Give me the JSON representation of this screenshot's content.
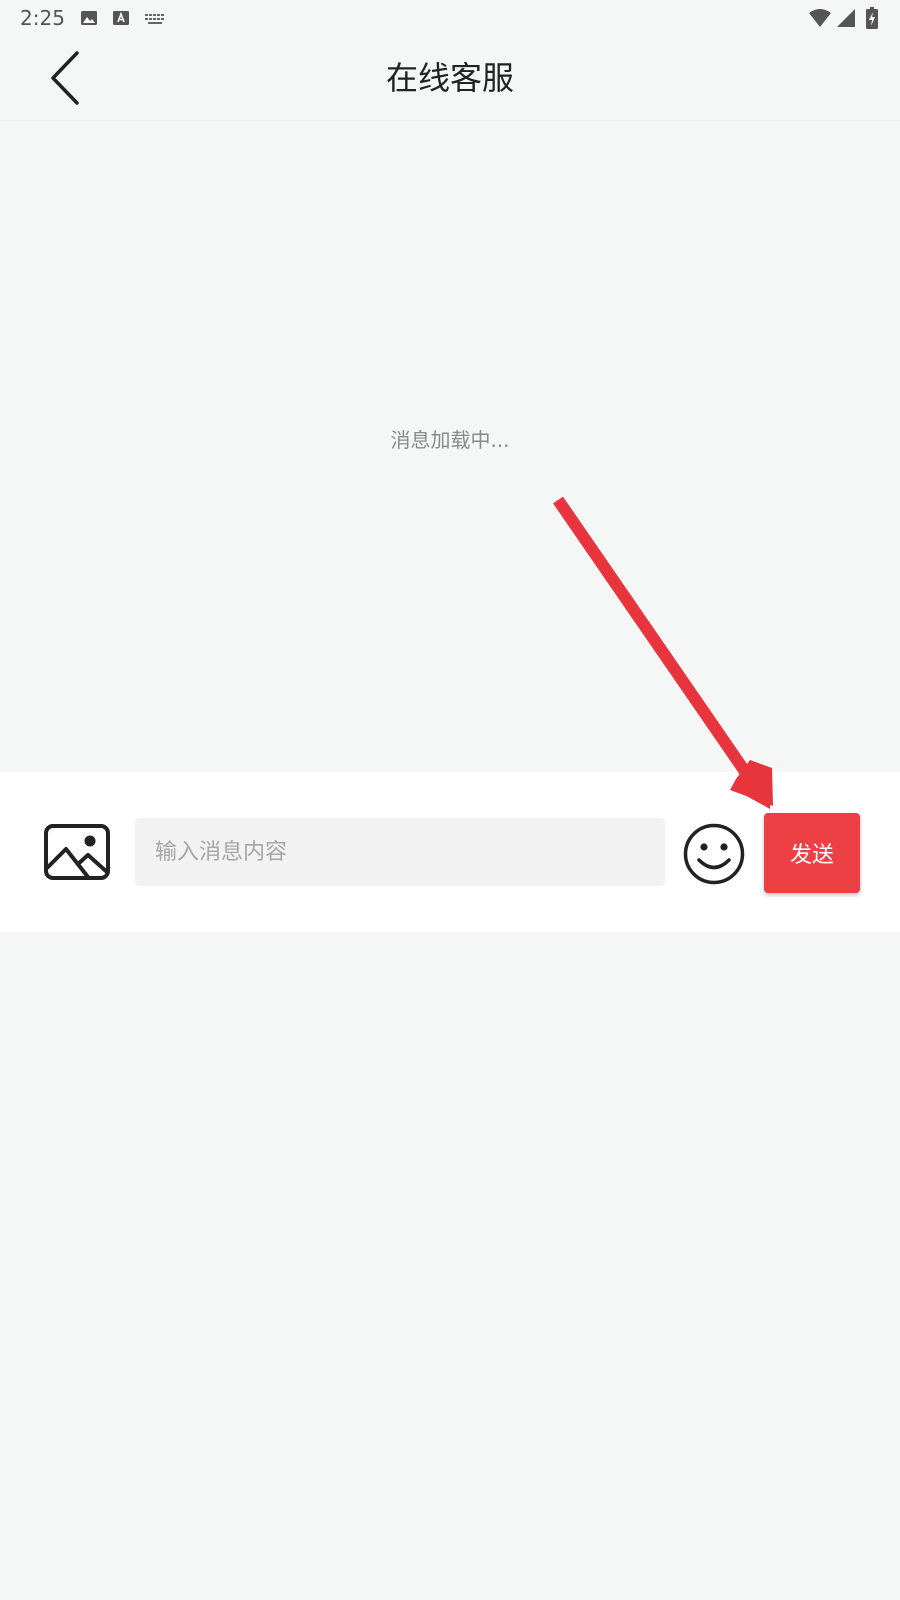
{
  "status_bar": {
    "time": "2:25",
    "left_icons": [
      "image-icon",
      "text-a-icon",
      "keyboard-icon"
    ],
    "right_icons": [
      "wifi-icon",
      "cellular-signal-icon",
      "battery-charging-icon"
    ]
  },
  "header": {
    "back_icon": "chevron-left-icon",
    "title": "在线客服"
  },
  "chat": {
    "loading_text": "消息加载中..."
  },
  "input_bar": {
    "image_icon": "image-icon",
    "placeholder": "输入消息内容",
    "value": "",
    "emoji_icon": "smiley-icon",
    "send_label": "发送"
  },
  "annotation": {
    "arrow_color": "#e8353d",
    "points_to": "send-button"
  },
  "colors": {
    "background": "#f5f7f7",
    "accent": "#ed4045",
    "input_bg": "#f2f2f2"
  }
}
